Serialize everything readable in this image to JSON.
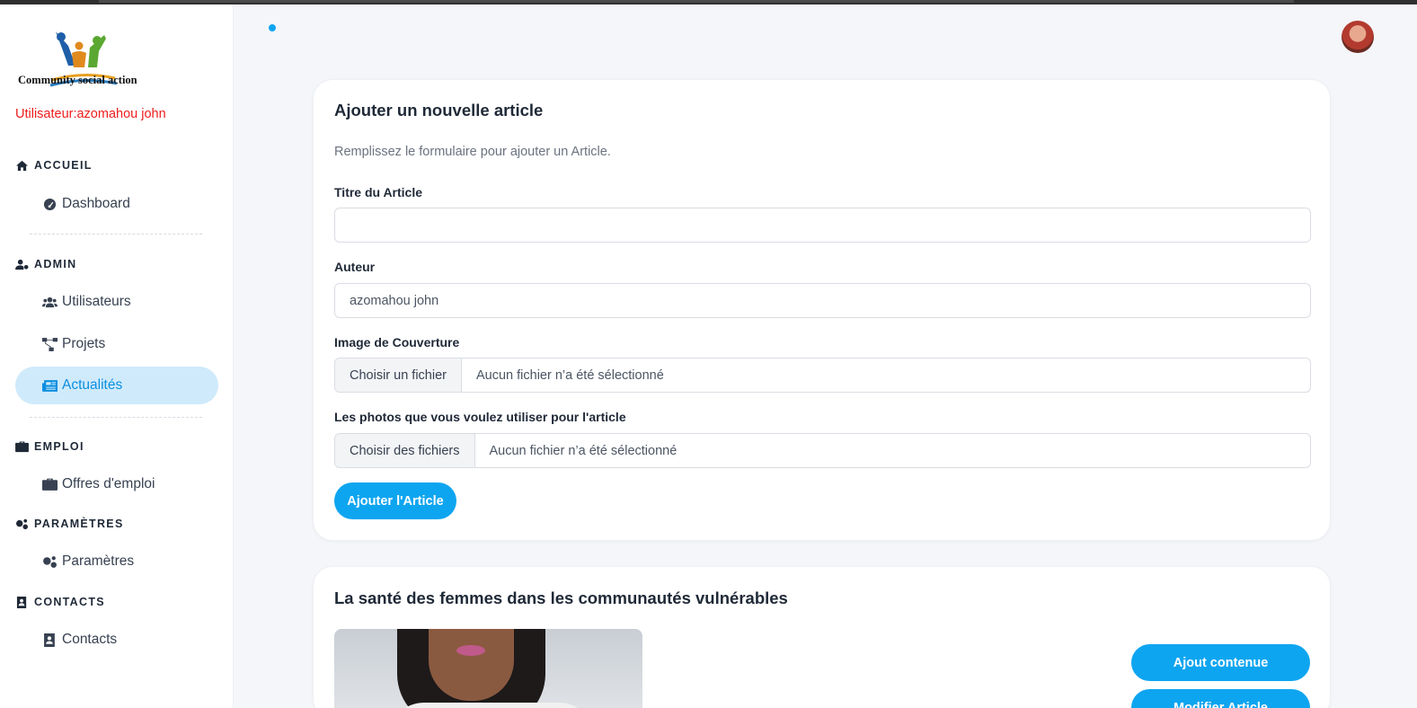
{
  "brand": {
    "name": "Community social action"
  },
  "user": {
    "label": "Utilisateur:azomahou john"
  },
  "sidebar": {
    "sections": [
      {
        "title": "ACCUEIL",
        "icon": "home-icon"
      },
      {
        "title": "ADMIN",
        "icon": "user-gear-icon"
      },
      {
        "title": "EMPLOI",
        "icon": "briefcase-icon"
      },
      {
        "title": "PARAMÈTRES",
        "icon": "gears-icon"
      },
      {
        "title": "CONTACTS",
        "icon": "contact-book-icon"
      }
    ],
    "items": [
      {
        "label": "Dashboard",
        "icon": "gauge-icon"
      },
      {
        "label": "Utilisateurs",
        "icon": "users-icon"
      },
      {
        "label": "Projets",
        "icon": "diagram-icon"
      },
      {
        "label": "Actualités",
        "icon": "newspaper-icon",
        "active": true
      },
      {
        "label": "Offres d'emploi",
        "icon": "briefcase-icon"
      },
      {
        "label": "Paramètres",
        "icon": "gears-icon"
      },
      {
        "label": "Contacts",
        "icon": "contact-book-icon"
      }
    ]
  },
  "form": {
    "title": "Ajouter un nouvelle article",
    "subtitle": "Remplissez le formulaire pour ajouter un Article.",
    "title_label": "Titre du Article",
    "title_value": "",
    "author_label": "Auteur",
    "author_value": "azomahou john",
    "cover_label": "Image de Couverture",
    "cover_button": "Choisir un fichier",
    "cover_status": "Aucun fichier n’a été sélectionné",
    "photos_label": "Les photos que vous voulez utiliser pour l'article",
    "photos_button": "Choisir des fichiers",
    "photos_status": "Aucun fichier n’a été sélectionné",
    "submit_label": "Ajouter l'Article"
  },
  "article": {
    "title": "La santé des femmes dans les communautés vulnérables",
    "add_content_label": "Ajout contenue",
    "edit_label": "Modifier Article"
  },
  "colors": {
    "accent": "#0ea5f0",
    "active_bg": "#cfeafb",
    "user_label": "#ef1c1c"
  }
}
